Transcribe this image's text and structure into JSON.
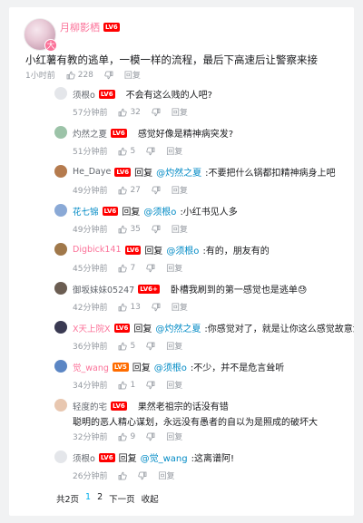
{
  "main_comment": {
    "username": "月柳影栖",
    "level": "LV6",
    "text": "小红薯有教的逃单，一模一样的流程，最后下高速后让警察来接",
    "time": "1小时前",
    "likes": "228",
    "reply_label": "回复"
  },
  "replies": [
    {
      "username": "须根o",
      "level": "LV6",
      "prefix": "",
      "mention": "",
      "text": "不会有这么贱的人吧?",
      "text2": "",
      "time": "57分钟前",
      "likes": "32",
      "reply_label": "回复",
      "name_color": "gray",
      "avatar_color": "#e4e6ea"
    },
    {
      "username": "灼然之夏",
      "level": "LV6",
      "prefix": "",
      "mention": "",
      "text": "感觉好像是精神病突发?",
      "text2": "",
      "time": "51分钟前",
      "likes": "5",
      "reply_label": "回复",
      "name_color": "gray",
      "avatar_color": "#9cc3a8"
    },
    {
      "username": "He_Daye",
      "level": "LV6",
      "prefix": "回复 ",
      "mention": "@灼然之夏",
      "text": " :不要把什么锅都扣精神病身上吧",
      "text2": "",
      "time": "49分钟前",
      "likes": "27",
      "reply_label": "回复",
      "name_color": "gray",
      "avatar_color": "#b57b4e"
    },
    {
      "username": "花七锦",
      "level": "LV6",
      "prefix": "回复 ",
      "mention": "@须根o",
      "text": " :小红书见人多",
      "text2": "",
      "time": "49分钟前",
      "likes": "35",
      "reply_label": "回复",
      "name_color": "blue",
      "avatar_color": "#8aa9d6"
    },
    {
      "username": "Digbick141",
      "level": "LV6",
      "prefix": "回复 ",
      "mention": "@须根o",
      "text": " :有的，朋友有的",
      "text2": "",
      "time": "45分钟前",
      "likes": "7",
      "reply_label": "回复",
      "name_color": "pink",
      "avatar_color": "#a0784a"
    },
    {
      "username": "御坂妹妹05247",
      "level": "LV6+",
      "prefix": "",
      "mention": "",
      "text": "卧槽我刷到的第一感觉也是逃单😓",
      "text2": "",
      "time": "42分钟前",
      "likes": "13",
      "reply_label": "回复",
      "name_color": "gray",
      "avatar_color": "#6b5d52"
    },
    {
      "username": "X天上院X",
      "level": "LV6",
      "prefix": "回复 ",
      "mention": "@灼然之夏",
      "text": " :你感觉对了，就是让你这么感觉故意演的",
      "text2": "",
      "time": "36分钟前",
      "likes": "5",
      "reply_label": "回复",
      "name_color": "pink",
      "avatar_color": "#3a3a52"
    },
    {
      "username": "觉_wang",
      "level": "LV5",
      "prefix": "回复 ",
      "mention": "@须根o",
      "text": " :不少，并不是危言耸听",
      "text2": "",
      "time": "34分钟前",
      "likes": "1",
      "reply_label": "回复",
      "name_color": "pink",
      "avatar_color": "#5b86c4"
    },
    {
      "username": "轻度的宅",
      "level": "LV6",
      "prefix": "",
      "mention": "",
      "text": "果然老祖宗的话没有错",
      "text2": "聪明的恶人精心谋划，永远没有愚者的自以为是照成的破坏大",
      "time": "32分钟前",
      "likes": "9",
      "reply_label": "回复",
      "name_color": "gray",
      "avatar_color": "#e8c7b0"
    },
    {
      "username": "须根o",
      "level": "LV6",
      "prefix": "回复 ",
      "mention": "@觉_wang",
      "text": " :这离谱阿!",
      "text2": "",
      "time": "26分钟前",
      "likes": "0",
      "reply_label": "回复",
      "name_color": "gray",
      "avatar_color": "#e4e6ea"
    }
  ],
  "pager": {
    "total": "共2页",
    "page1": "1",
    "page2": "2",
    "next": "下一页",
    "collapse": "收起"
  },
  "colors": {
    "accent_pink": "#fb7299",
    "link_blue": "#008ac5",
    "meta_gray": "#9499a0"
  }
}
